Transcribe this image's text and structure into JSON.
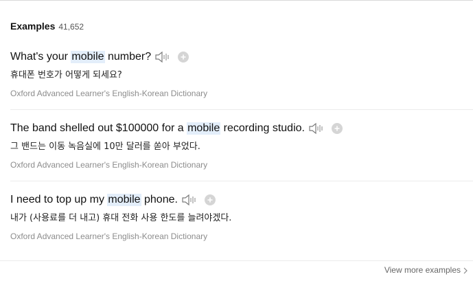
{
  "section": {
    "title": "Examples",
    "count": "41,652"
  },
  "examples": [
    {
      "before": "What's your ",
      "highlight": "mobile",
      "after": " number?",
      "translation": "휴대폰 번호가 어떻게 되세요?",
      "source": "Oxford Advanced Learner's English-Korean Dictionary"
    },
    {
      "before": "The band shelled out $100000 for a ",
      "highlight": "mobile",
      "after": " recording studio.",
      "translation": "그 밴드는 이동 녹음실에 10만 달러를 쏟아 부었다.",
      "source": "Oxford Advanced Learner's English-Korean Dictionary"
    },
    {
      "before": "I need to top up my ",
      "highlight": "mobile",
      "after": " phone.",
      "translation": "내가 (사용료를 더 내고) 휴대 전화 사용 한도를 늘려야겠다.",
      "source": "Oxford Advanced Learner's English-Korean Dictionary"
    }
  ],
  "footer": {
    "view_more": "View more examples"
  },
  "icons": {
    "speaker": "speaker-icon",
    "add": "plus-circle-icon",
    "chevron": "chevron-right-icon"
  },
  "colors": {
    "highlight": "#e3eefa",
    "source_text": "#8c8c8c",
    "add_button": "#d5d5d5"
  }
}
